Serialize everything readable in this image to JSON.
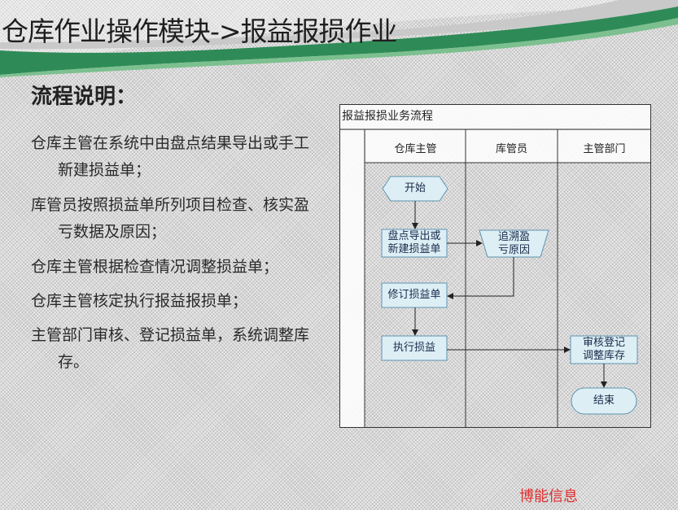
{
  "slide": {
    "title": "仓库作业操作模块->报益报损作业",
    "heading": "流程说明：",
    "steps": [
      "仓库主管在系统中由盘点结果导出或手工新建损益单；",
      "库管员按照损益单所列项目检查、核实盈亏数据及原因；",
      "仓库主管根据检查情况调整损益单；",
      "仓库主管核定执行报益报损单；",
      "主管部门审核、登记损益单，系统调整库存。"
    ],
    "brand": "博能信息"
  },
  "flowchart": {
    "title": "报益报损业务流程",
    "lanes": [
      "仓库主管",
      "库管员",
      "主管部门"
    ],
    "nodes": {
      "start": "开始",
      "export": [
        "盘点导出或",
        "新建损益单"
      ],
      "trace": [
        "追溯盈",
        "亏原因"
      ],
      "revise": "修订损益单",
      "execute": "执行损益",
      "audit": [
        "审核登记",
        "调整库存"
      ],
      "end": "结束"
    }
  },
  "colors": {
    "header_green": "#2e8b57",
    "node_fill": "#ddeef5",
    "node_stroke": "#5f94b0",
    "line": "#222222",
    "brand_red": "#e03030"
  }
}
